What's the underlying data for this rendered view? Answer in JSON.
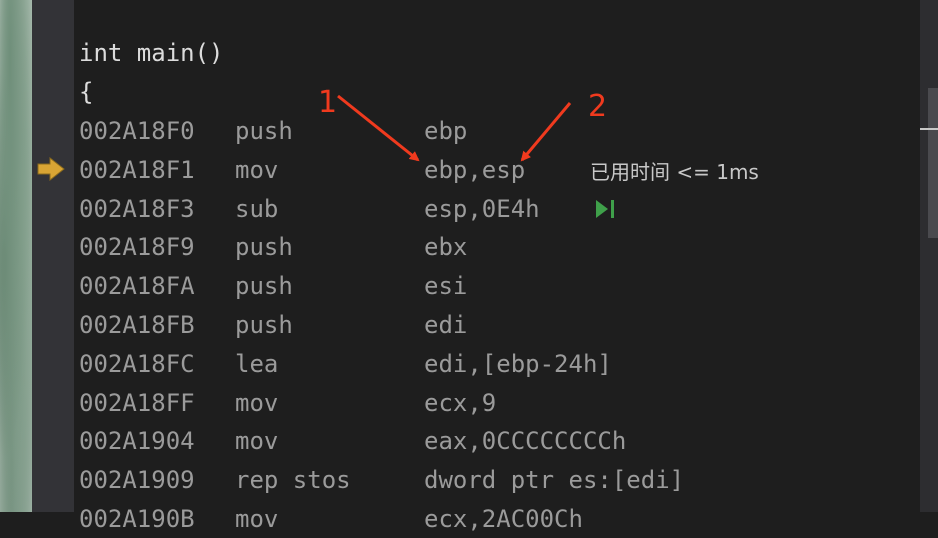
{
  "source": {
    "func_sig": "int main()",
    "open_brace": "{"
  },
  "disassembly": [
    {
      "addr": "002A18F0",
      "mnemonic": "push",
      "operands": "ebp"
    },
    {
      "addr": "002A18F1",
      "mnemonic": "mov",
      "operands": "ebp,esp"
    },
    {
      "addr": "002A18F3",
      "mnemonic": "sub",
      "operands": "esp,0E4h"
    },
    {
      "addr": "002A18F9",
      "mnemonic": "push",
      "operands": "ebx"
    },
    {
      "addr": "002A18FA",
      "mnemonic": "push",
      "operands": "esi"
    },
    {
      "addr": "002A18FB",
      "mnemonic": "push",
      "operands": "edi"
    },
    {
      "addr": "002A18FC",
      "mnemonic": "lea",
      "operands": "edi,[ebp-24h]"
    },
    {
      "addr": "002A18FF",
      "mnemonic": "mov",
      "operands": "ecx,9"
    },
    {
      "addr": "002A1904",
      "mnemonic": "mov",
      "operands": "eax,0CCCCCCCCh"
    },
    {
      "addr": "002A1909",
      "mnemonic": "rep stos",
      "operands": "dword ptr es:[edi]"
    },
    {
      "addr": "002A190B",
      "mnemonic": "mov",
      "operands": "ecx,2AC00Ch"
    }
  ],
  "perf_tip": "已用时间 <= 1ms",
  "annotations": {
    "label_1": "1",
    "label_2": "2"
  },
  "colors": {
    "ip_arrow": "#d9a534",
    "annotation": "#f03a1e",
    "run_to_cursor": "#3fa04a"
  },
  "icons": {
    "current_instruction": "instruction-pointer-arrow-icon",
    "run_to_cursor": "run-to-cursor-icon"
  }
}
